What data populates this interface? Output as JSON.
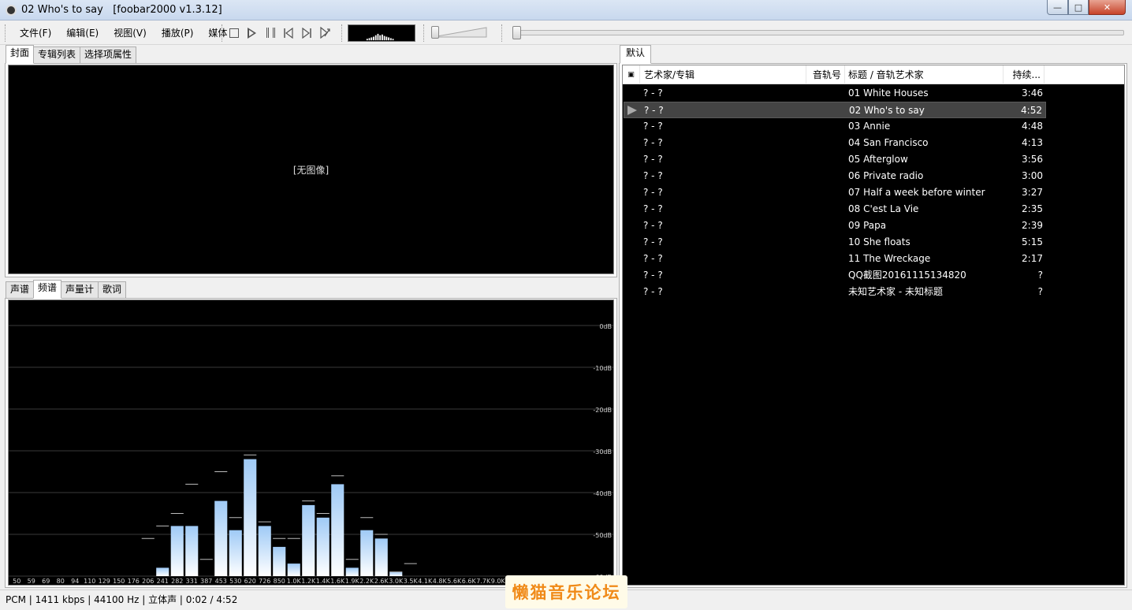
{
  "window": {
    "title": "02 Who's to say   [foobar2000 v1.3.12]",
    "controls": [
      "minimize",
      "maximize",
      "close"
    ]
  },
  "menu": [
    "文件(F)",
    "编辑(E)",
    "视图(V)",
    "播放(P)",
    "媒体"
  ],
  "toolbar": {
    "buttons": [
      "stop-icon",
      "play-icon",
      "pause-icon",
      "prev-icon",
      "next-icon",
      "random-icon"
    ],
    "volume_level": 0.05,
    "seek_position": 0.007
  },
  "left_tabs_top": [
    "封面",
    "专辑列表",
    "选择项属性"
  ],
  "left_tabs_top_active": 0,
  "cover": {
    "no_image_text": "[无图像]"
  },
  "left_tabs_bottom": [
    "声谱",
    "频谱",
    "声量计",
    "歌词"
  ],
  "left_tabs_bottom_active": 1,
  "spectrum": {
    "db_labels": [
      "0dB",
      "-10dB",
      "-20dB",
      "-30dB",
      "-40dB",
      "-50dB",
      "-60dB"
    ],
    "freq_labels": [
      "50",
      "59",
      "69",
      "80",
      "94",
      "110",
      "129",
      "150",
      "176",
      "206",
      "241",
      "282",
      "331",
      "387",
      "453",
      "530",
      "620",
      "726",
      "850",
      "1.0K",
      "1.2K",
      "1.4K",
      "1.6K",
      "1.9K",
      "2.2K",
      "2.6K",
      "3.0K",
      "3.5K",
      "4.1K",
      "4.8K",
      "5.6K",
      "6.6K",
      "7.7K",
      "9.0K"
    ],
    "bars_db": [
      -60,
      -60,
      -60,
      -60,
      -60,
      -60,
      -60,
      -60,
      -60,
      -60,
      -58,
      -48,
      -48,
      -60,
      -42,
      -49,
      -32,
      -48,
      -53,
      -57,
      -43,
      -46,
      -38,
      -58,
      -49,
      -51,
      -59,
      -60,
      -60,
      -60,
      -60,
      -60,
      -60,
      -60
    ],
    "peaks_db": [
      null,
      null,
      null,
      null,
      null,
      null,
      null,
      null,
      null,
      -51,
      -48,
      -45,
      -38,
      -56,
      -35,
      -46,
      -31,
      -47,
      -51,
      -51,
      -42,
      -45,
      -36,
      -56,
      -46,
      -50,
      -59,
      -57,
      null,
      null,
      null,
      null,
      null,
      null
    ],
    "colors": {
      "bar_top": "#9fcaf6",
      "bar_bottom": "#ffffff",
      "grid": "#3a3a3a",
      "label": "#d0d0d0"
    }
  },
  "playlist": {
    "tab": "默认",
    "columns": {
      "playing": "▣",
      "artist_album": "艺术家/专辑",
      "track_no": "音轨号",
      "title_artist": "标题 / 音轨艺术家",
      "duration": "持续..."
    },
    "rows": [
      {
        "artist_album": "? - ?",
        "title": "01 White Houses",
        "duration": "3:46"
      },
      {
        "artist_album": "? - ?",
        "title": "02 Who's to say",
        "duration": "4:52",
        "playing": true
      },
      {
        "artist_album": "? - ?",
        "title": "03 Annie",
        "duration": "4:48"
      },
      {
        "artist_album": "? - ?",
        "title": "04 San Francisco",
        "duration": "4:13"
      },
      {
        "artist_album": "? - ?",
        "title": "05 Afterglow",
        "duration": "3:56"
      },
      {
        "artist_album": "? - ?",
        "title": "06 Private radio",
        "duration": "3:00"
      },
      {
        "artist_album": "? - ?",
        "title": "07 Half a week before winter",
        "duration": "3:27"
      },
      {
        "artist_album": "? - ?",
        "title": "08 C'est La Vie",
        "duration": "2:35"
      },
      {
        "artist_album": "? - ?",
        "title": "09 Papa",
        "duration": "2:39"
      },
      {
        "artist_album": "? - ?",
        "title": "10 She floats",
        "duration": "5:15"
      },
      {
        "artist_album": "? - ?",
        "title": "11 The Wreckage",
        "duration": "2:17"
      },
      {
        "artist_album": "? - ?",
        "title": "QQ截图20161115134820",
        "duration": "?"
      },
      {
        "artist_album": "? - ?",
        "title": "未知艺术家 - 未知标题",
        "duration": "?"
      }
    ]
  },
  "status": {
    "text": "PCM | 1411 kbps | 44100 Hz | 立体声 | 0:02 / 4:52"
  },
  "watermark": {
    "text": "懒猫音乐论坛"
  }
}
